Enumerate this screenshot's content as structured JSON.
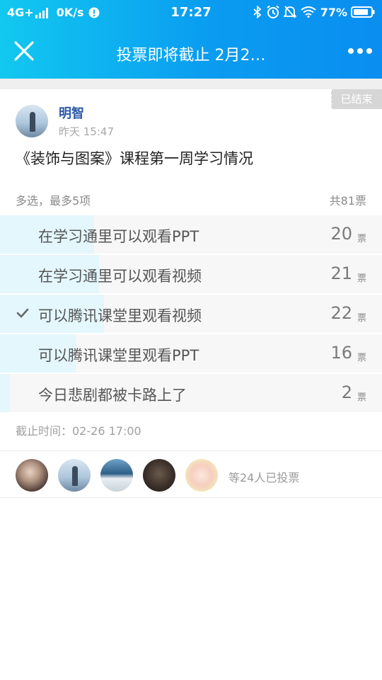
{
  "status_bar": {
    "network": "4G+",
    "speed": "0K/s",
    "time": "17:27",
    "battery": "77%"
  },
  "nav": {
    "title": "投票即将截止 2月2…"
  },
  "badge": "已结束",
  "author": {
    "name": "明智",
    "time": "昨天 15:47"
  },
  "poll": {
    "title": "《装饰与图案》课程第一周学习情况",
    "mode": "多选，最多5项",
    "total": "共81票",
    "deadline": "截止时间：02-26 17:00",
    "options": [
      {
        "label": "在学习通里可以观看PPT",
        "count": "20",
        "unit": "票",
        "share": 0.247,
        "checked": false
      },
      {
        "label": "在学习通里可以观看视频",
        "count": "21",
        "unit": "票",
        "share": 0.259,
        "checked": false
      },
      {
        "label": "可以腾讯课堂里观看视频",
        "count": "22",
        "unit": "票",
        "share": 0.272,
        "checked": true
      },
      {
        "label": "可以腾讯课堂里观看PPT",
        "count": "16",
        "unit": "票",
        "share": 0.198,
        "checked": false
      },
      {
        "label": "今日悲剧都被卡路上了",
        "count": "2",
        "unit": "票",
        "share": 0.025,
        "checked": false
      }
    ]
  },
  "voters": {
    "summary": "等24人已投票"
  },
  "colors": {
    "header_start": "#12c8f0",
    "header_end": "#0a8ef0",
    "bar_fill": "#e3f7fd",
    "author_name": "#2d5aa8"
  }
}
